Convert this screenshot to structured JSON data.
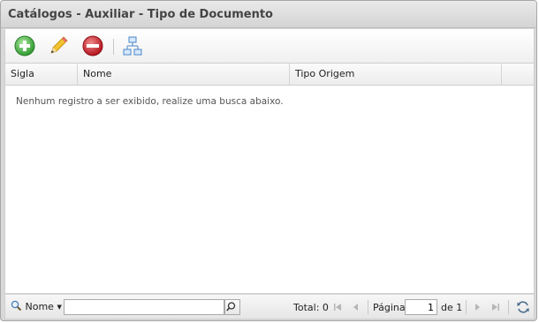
{
  "window": {
    "title": "Catálogos - Auxiliar - Tipo de Documento"
  },
  "toolbar": {
    "buttons": [
      {
        "name": "add",
        "icon": "plus-circle-icon",
        "color": "#3aa83a"
      },
      {
        "name": "edit",
        "icon": "pencil-icon",
        "color": "#f0b400"
      },
      {
        "name": "delete",
        "icon": "minus-circle-icon",
        "color": "#c8202a"
      },
      {
        "name": "hierarchy",
        "icon": "hierarchy-icon",
        "color": "#5a93d2"
      }
    ]
  },
  "grid": {
    "columns": [
      "Sigla",
      "Nome",
      "Tipo Origem"
    ],
    "empty_message": "Nenhum registro a ser exibido, realize uma busca abaixo."
  },
  "pagination": {
    "search_field": "Nome",
    "search_value": "",
    "total_label": "Total:",
    "total_value": "0",
    "page_label": "Página",
    "current_page": "1",
    "of_label": "de 1"
  }
}
